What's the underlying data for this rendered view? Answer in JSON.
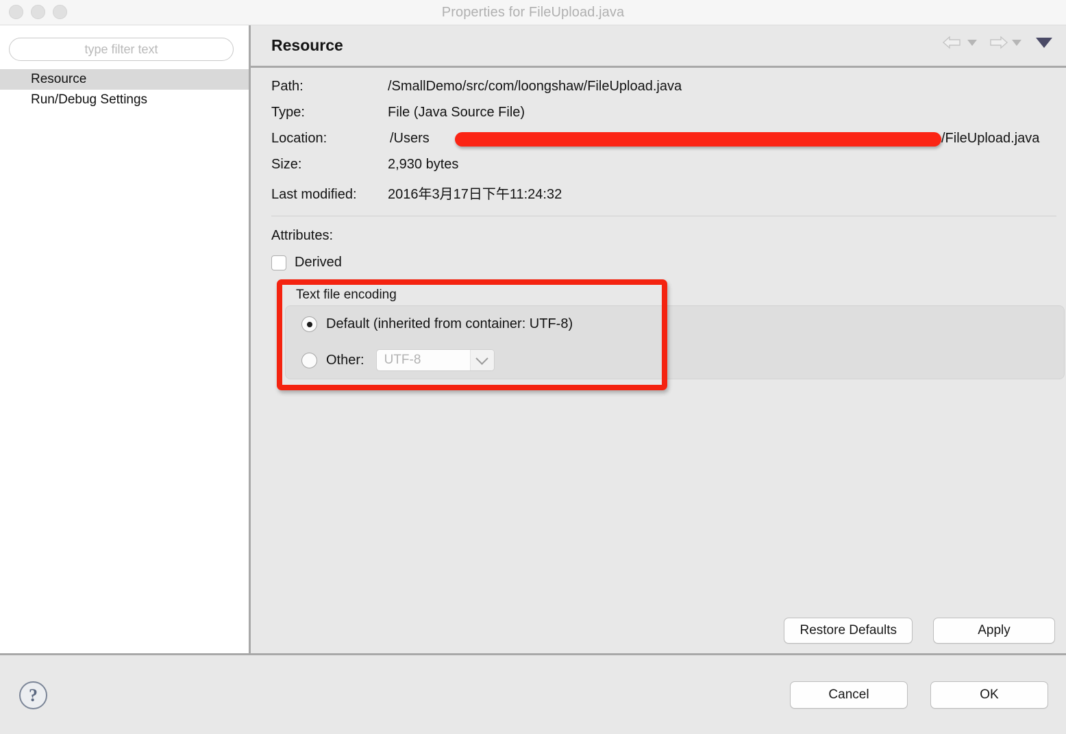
{
  "window": {
    "title": "Properties for FileUpload.java",
    "traffic_lights": [
      "close",
      "minimize",
      "zoom"
    ]
  },
  "sidebar": {
    "filter": {
      "placeholder": "type filter text",
      "value": ""
    },
    "items": [
      {
        "label": "Resource",
        "selected": true
      },
      {
        "label": "Run/Debug Settings",
        "selected": false
      }
    ]
  },
  "main": {
    "header": {
      "title": "Resource",
      "nav": {
        "back": "back-arrow",
        "back_menu": "triangle-down",
        "forward": "forward-arrow",
        "forward_menu": "triangle-down",
        "more": "chevron-down"
      }
    },
    "properties": [
      {
        "label": "Path:",
        "value": "/SmallDemo/src/com/loongshaw/FileUpload.java"
      },
      {
        "label": "Type:",
        "value": "File  (Java Source File)"
      },
      {
        "label": "Location:",
        "value": "/Users",
        "redacted": true,
        "value_tail": "/FileUpload.java"
      },
      {
        "label": "Size:",
        "value": "2,930  bytes"
      },
      {
        "label": "Last modified:",
        "value": "2016年3月17日下午11:24:32"
      }
    ],
    "attributes": {
      "label": "Attributes:",
      "derived": {
        "label": "Derived",
        "checked": false
      }
    },
    "encoding": {
      "group_title": "Text file encoding",
      "default_option": {
        "label": "Default (inherited from container: UTF-8)",
        "selected": true
      },
      "other_option": {
        "label": "Other:",
        "selected": false,
        "combo_value": "UTF-8",
        "combo_disabled": true
      },
      "highlight_color": "#f42310"
    },
    "panel_buttons": {
      "restore_defaults": "Restore Defaults",
      "apply": "Apply"
    }
  },
  "footer": {
    "help": "?",
    "cancel": "Cancel",
    "ok": "OK"
  }
}
